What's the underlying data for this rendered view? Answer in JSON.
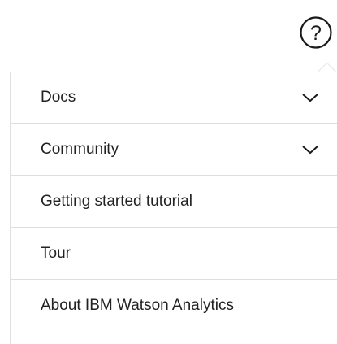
{
  "help_button": {
    "icon": "question-circle-icon",
    "glyph": "?"
  },
  "menu": {
    "items": [
      {
        "label": "Docs",
        "expandable": true
      },
      {
        "label": "Community",
        "expandable": true
      },
      {
        "label": "Getting started tutorial",
        "expandable": false
      },
      {
        "label": "Tour",
        "expandable": false
      },
      {
        "label": "About IBM Watson Analytics",
        "expandable": false
      }
    ]
  },
  "colors": {
    "text": "#222222",
    "icon": "#1a1a1a",
    "divider": "#dedede",
    "background": "#ffffff"
  }
}
